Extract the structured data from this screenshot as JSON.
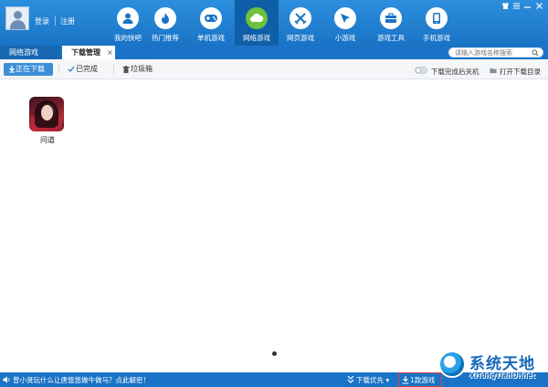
{
  "header": {
    "login_label": "登录",
    "register_label": "注册",
    "nav": [
      {
        "label": "我的快吧",
        "icon": "user-icon"
      },
      {
        "label": "热门推荐",
        "icon": "flame-icon"
      },
      {
        "label": "单机游戏",
        "icon": "gamepad-icon"
      },
      {
        "label": "网络游戏",
        "icon": "cloud-icon",
        "active": true
      },
      {
        "label": "网页游戏",
        "icon": "swords-icon"
      },
      {
        "label": "小游戏",
        "icon": "cursor-icon"
      },
      {
        "label": "游戏工具",
        "icon": "toolbox-icon"
      },
      {
        "label": "手机游戏",
        "icon": "phone-icon"
      }
    ]
  },
  "tabs": {
    "online_games": "网络游戏",
    "download_manager": "下载管理",
    "close_symbol": "×"
  },
  "search": {
    "placeholder": "请输入游戏名称搜索"
  },
  "toolbar": {
    "downloading": "正在下载",
    "completed": "已完成",
    "trash": "垃圾箱",
    "shutdown_after": "下载完成后关机",
    "open_dir": "打开下载目录"
  },
  "downloads": [
    {
      "name": "问道"
    }
  ],
  "statusbar": {
    "message": "曾小贤玩什么让唐悠悠做牛做马？点此解密！",
    "priority": "下载优先",
    "priority_chevron": "▾",
    "games_count": "1款游戏"
  },
  "watermark": {
    "title": "系统天地",
    "url": "XiTongTianDi.net"
  },
  "colors": {
    "header_blue": "#1a73c6",
    "active_nav": "#0f5fa8",
    "active_icon_green": "#6cc23a"
  }
}
